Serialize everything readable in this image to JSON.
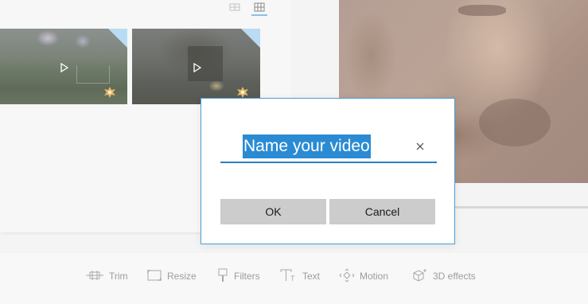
{
  "icons": {
    "list_view": "list-view-icon",
    "grid_view": "grid-view-icon",
    "play": "play-icon",
    "star_badge": "star-badge-icon",
    "clear": "close-icon"
  },
  "toolbar": {
    "items": [
      {
        "label": "Trim",
        "icon": "trim-icon"
      },
      {
        "label": "Resize",
        "icon": "resize-icon"
      },
      {
        "label": "Filters",
        "icon": "filters-icon"
      },
      {
        "label": "Text",
        "icon": "text-icon"
      },
      {
        "label": "Motion",
        "icon": "motion-icon"
      },
      {
        "label": "3D effects",
        "icon": "3d-effects-icon"
      }
    ]
  },
  "dialog": {
    "name_value": "Name your video",
    "ok_label": "OK",
    "cancel_label": "Cancel"
  },
  "colors": {
    "accent": "#2a8bd3",
    "dialog_border": "#4a9ed6",
    "button_bg": "#cccccc",
    "toolbar_text": "#9c9c9c"
  }
}
